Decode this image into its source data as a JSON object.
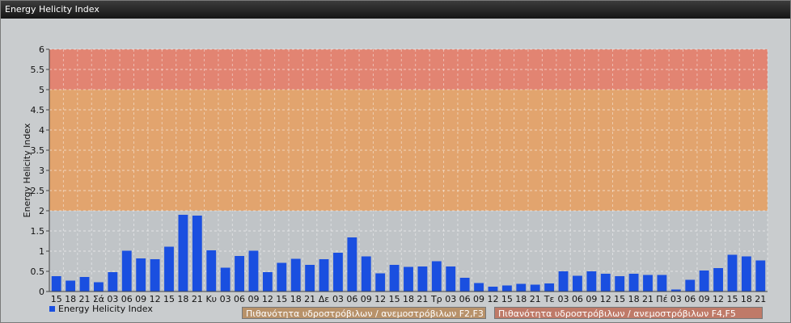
{
  "window": {
    "title": "Energy Helicity Index"
  },
  "colors": {
    "bar": "#1a4fe0",
    "zone_low": "#c0c4c7",
    "zone_mid": "#e2a46e",
    "zone_high": "#e28472"
  },
  "legend": {
    "series": "Energy Helicity Index",
    "zone_f2f3": "Πιθανότητα υδροστρόβιλων / ανεμοστρόβιλων F2,F3",
    "zone_f4f5": "Πιθανότητα υδροστρόβιλων / ανεμοστρόβιλων F4,F5"
  },
  "chart_data": {
    "type": "bar",
    "ylabel": "Energy Helicity Index",
    "ylim": [
      0,
      6
    ],
    "yticks": [
      "0",
      "0.5",
      "1",
      "1.5",
      "2",
      "2.5",
      "3",
      "3.5",
      "4",
      "4.5",
      "5",
      "5.5",
      "6"
    ],
    "grid": true,
    "zones": [
      {
        "from": 2,
        "to": 5,
        "label": "Πιθανότητα υδροστρόβιλων / ανεμοστρόβιλων F2,F3"
      },
      {
        "from": 5,
        "to": 6,
        "label": "Πιθανότητα υδροστρόβιλων / ανεμοστρόβιλων F4,F5"
      }
    ],
    "categories": [
      "15",
      "18",
      "21",
      "Σά",
      "03",
      "06",
      "09",
      "12",
      "15",
      "18",
      "21",
      "Κυ",
      "03",
      "06",
      "09",
      "12",
      "15",
      "18",
      "21",
      "Δε",
      "03",
      "06",
      "09",
      "12",
      "15",
      "18",
      "21",
      "Τρ",
      "03",
      "06",
      "09",
      "12",
      "15",
      "18",
      "21",
      "Τε",
      "03",
      "06",
      "09",
      "12",
      "15",
      "18",
      "21",
      "Πέ",
      "03",
      "06",
      "09",
      "12",
      "15",
      "18",
      "21"
    ],
    "series": [
      {
        "name": "Energy Helicity Index",
        "values": [
          0.38,
          0.27,
          0.36,
          0.23,
          0.48,
          1.01,
          0.82,
          0.8,
          1.11,
          1.9,
          1.88,
          1.02,
          0.59,
          0.88,
          1.01,
          0.48,
          0.71,
          0.81,
          0.66,
          0.8,
          0.96,
          1.34,
          0.87,
          0.45,
          0.66,
          0.61,
          0.62,
          0.75,
          0.62,
          0.34,
          0.21,
          0.12,
          0.15,
          0.19,
          0.17,
          0.2,
          0.5,
          0.39,
          0.5,
          0.44,
          0.38,
          0.44,
          0.41,
          0.41,
          0.05,
          0.29,
          0.52,
          0.58,
          0.91,
          0.87,
          0.77
        ]
      }
    ]
  }
}
